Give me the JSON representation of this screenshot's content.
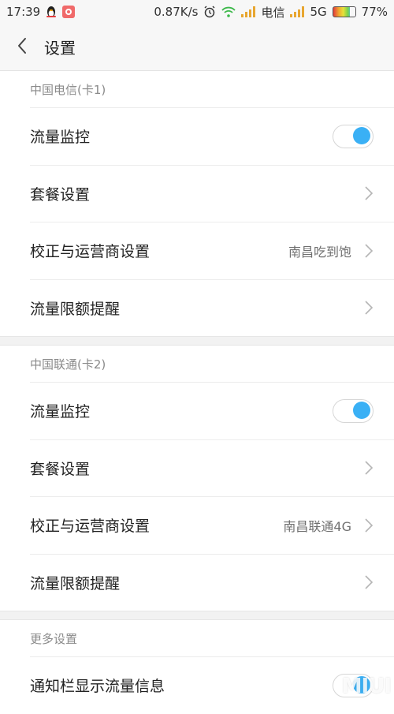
{
  "status_bar": {
    "time": "17:39",
    "speed": "0.87K/s",
    "carrier1": "电信",
    "network2": "5G",
    "battery": "77%",
    "battery_level": 0.77
  },
  "nav": {
    "title": "设置"
  },
  "sections": [
    {
      "header": "中国电信(卡1)",
      "rows": [
        {
          "label": "流量监控",
          "toggle_on": true
        },
        {
          "label": "套餐设置"
        },
        {
          "label": "校正与运营商设置",
          "value": "南昌吃到饱"
        },
        {
          "label": "流量限额提醒"
        }
      ]
    },
    {
      "header": "中国联通(卡2)",
      "rows": [
        {
          "label": "流量监控",
          "toggle_on": true
        },
        {
          "label": "套餐设置"
        },
        {
          "label": "校正与运营商设置",
          "value": "南昌联通4G"
        },
        {
          "label": "流量限额提醒"
        }
      ]
    },
    {
      "header": "更多设置",
      "rows": [
        {
          "label": "通知栏显示流量信息",
          "toggle_on": true
        }
      ]
    }
  ],
  "watermark": "MIUI",
  "colors": {
    "accent": "#3ab0f5"
  }
}
